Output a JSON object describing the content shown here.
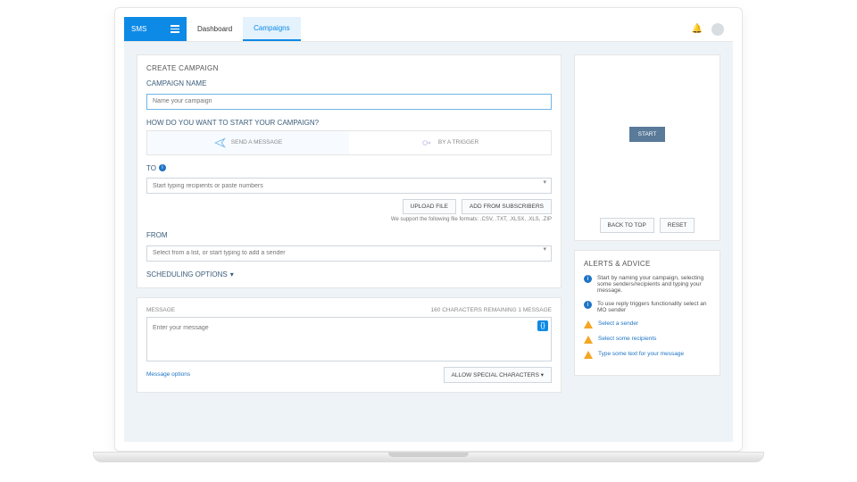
{
  "topbar": {
    "brand": "SMS",
    "tabs": [
      "Dashboard",
      "Campaigns"
    ],
    "active_tab": 1
  },
  "create": {
    "page_title": "CREATE CAMPAIGN",
    "name_label": "CAMPAIGN NAME",
    "name_placeholder": "Name your campaign",
    "start_label": "HOW DO YOU WANT TO START YOUR CAMPAIGN?",
    "opt_send": "SEND A MESSAGE",
    "opt_trigger": "BY A TRIGGER",
    "to_label": "TO",
    "to_placeholder": "Start typing recipients or paste numbers",
    "upload_btn": "UPLOAD FILE",
    "add_subs_btn": "ADD FROM SUBSCRIBERS",
    "file_hint": "We support the following file formats: .CSV, .TXT, .XLSX, .XLS, .ZIP",
    "from_label": "FROM",
    "from_placeholder": "Select from a list, or start typing to add a sender",
    "sched_label": "SCHEDULING OPTIONS"
  },
  "message": {
    "label": "MESSAGE",
    "remaining": "160 CHARACTERS REMAINING   1 MESSAGE",
    "placeholder": "Enter your message",
    "options": "Message options",
    "allow_special": "ALLOW SPECIAL CHARACTERS"
  },
  "preview": {
    "start": "START",
    "back": "BACK TO TOP",
    "reset": "RESET"
  },
  "alerts": {
    "title": "ALERTS & ADVICE",
    "info1": "Start by naming your campaign, selecting some senders/recipients and typing your message.",
    "info2": "To use reply triggers functionality select an MO sender",
    "w1": "Select a sender",
    "w2": "Select some recipients",
    "w3": "Type some text for your message"
  }
}
